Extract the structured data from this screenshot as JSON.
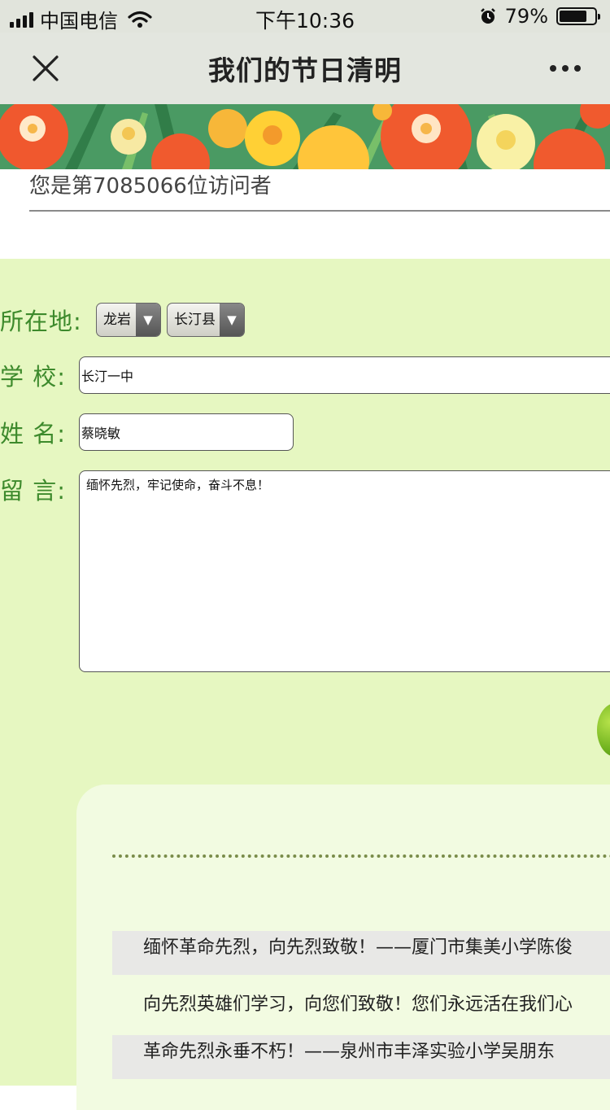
{
  "status_bar": {
    "carrier": "中国电信",
    "time": "下午10:36",
    "battery": "79%",
    "battery_level": 0.79,
    "icons": [
      "signal-icon",
      "wifi-icon",
      "alarm-icon",
      "battery-icon"
    ]
  },
  "nav": {
    "title": "我们的节日清明",
    "close_icon": "close-icon",
    "more_icon": "more-icon"
  },
  "visitor": {
    "text": "您是第7085066位访问者"
  },
  "form": {
    "location_label": "所在地:",
    "city": "龙岩",
    "county": "长汀县",
    "school_label": "学 校:",
    "school_value": "长汀一中",
    "name_label": "姓 名:",
    "name_value": "蔡晓敏",
    "message_label": "留 言:",
    "message_value": "缅怀先烈，牢记使命，奋斗不息！"
  },
  "messages": [
    {
      "text": "缅怀革命先烈，向先烈致敬！——厦门市集美小学陈俊"
    },
    {
      "text": "向先烈英雄们学习，向您们致敬！您们永远活在我们心"
    },
    {
      "text": "革命先烈永垂不朽！——泉州市丰泽实验小学吴朋东"
    }
  ],
  "colors": {
    "label_green": "#3d8a2c",
    "form_bg": "#e6f7c1",
    "panel_bg": "#f2fbe1"
  }
}
